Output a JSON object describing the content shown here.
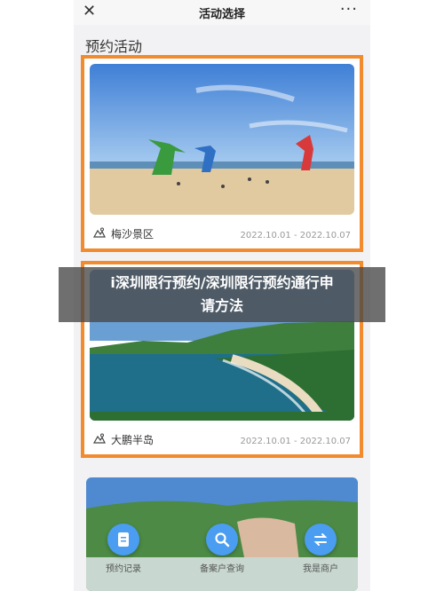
{
  "header": {
    "close_icon": "close-icon",
    "title": "活动选择",
    "more_label": "···"
  },
  "section_title": "预约活动",
  "cards": [
    {
      "location": "梅沙景区",
      "date": "2022.10.01 - 2022.10.07",
      "icon": "scenic-area-icon"
    },
    {
      "location": "大鹏半岛",
      "date": "2022.10.01 - 2022.10.07",
      "icon": "scenic-area-icon"
    }
  ],
  "overlay": {
    "line1": "i深圳限行预约/深圳限行预约通行申",
    "line2": "请方法"
  },
  "bottom_nav": [
    {
      "label": "预约记录",
      "icon": "document-icon"
    },
    {
      "label": "备案户查询",
      "icon": "search-icon"
    },
    {
      "label": "我是商户",
      "icon": "swap-icon"
    }
  ],
  "colors": {
    "accent_border": "#f28a2e",
    "nav_button": "#4a9df0"
  }
}
